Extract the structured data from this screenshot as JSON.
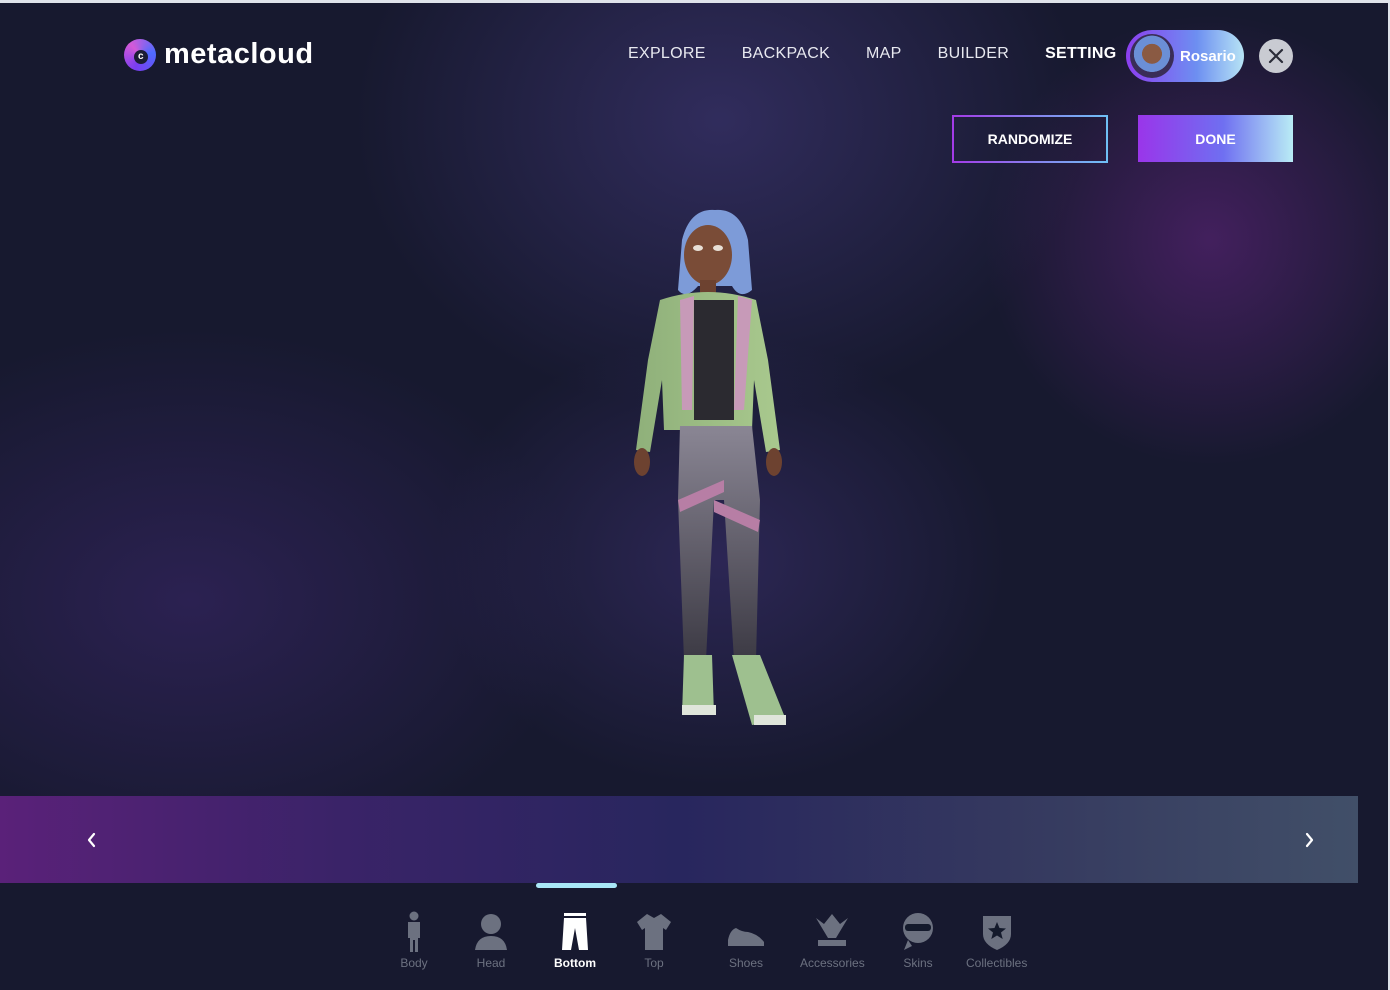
{
  "app": {
    "brand": "metacloud",
    "logo_letter": "c"
  },
  "nav": {
    "items": [
      "EXPLORE",
      "BACKPACK",
      "MAP",
      "BUILDER",
      "SETTING"
    ],
    "active": "SETTING"
  },
  "user": {
    "name": "Rosario"
  },
  "actions": {
    "randomize": "RANDOMIZE",
    "done": "DONE"
  },
  "tabs": [
    {
      "label": "Body",
      "icon": "body-icon"
    },
    {
      "label": "Head",
      "icon": "head-icon"
    },
    {
      "label": "Bottom",
      "icon": "pants-icon",
      "active": true
    },
    {
      "label": "Top",
      "icon": "shirt-icon"
    },
    {
      "label": "Shoes",
      "icon": "shoe-icon"
    },
    {
      "label": "Accessories",
      "icon": "jester-hat-icon"
    },
    {
      "label": "Skins",
      "icon": "ninja-mask-icon"
    },
    {
      "label": "Collectibles",
      "icon": "star-shield-icon"
    }
  ],
  "colors": {
    "accent_purple": "#9a35ea",
    "accent_cyan": "#a9e7f7",
    "background": "#17192f"
  }
}
